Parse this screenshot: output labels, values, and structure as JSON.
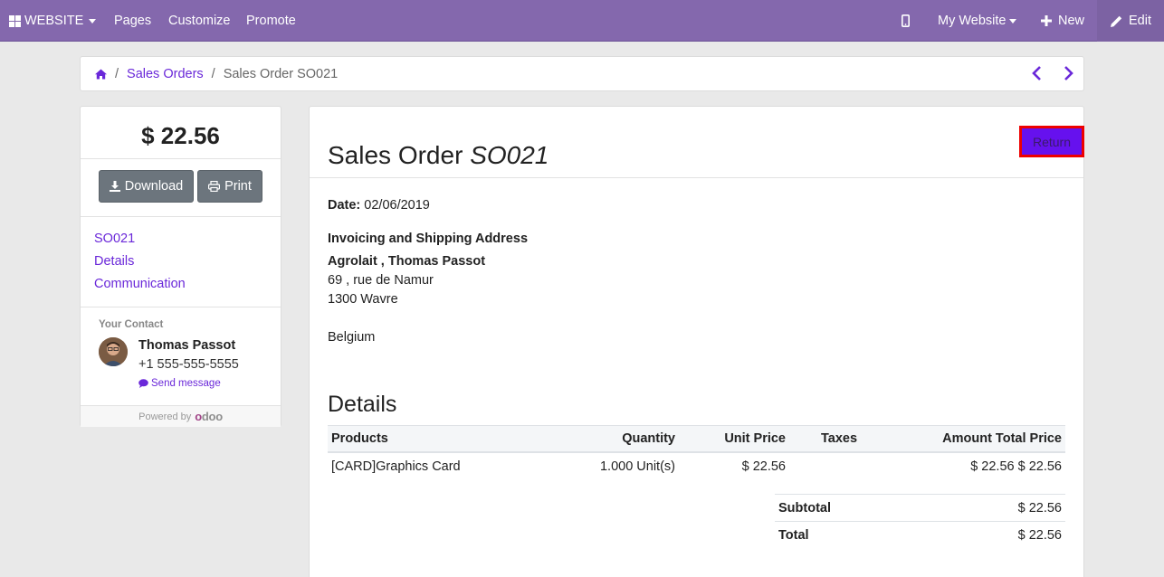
{
  "topbar": {
    "website_label": "WEBSITE",
    "menu": [
      "Pages",
      "Customize",
      "Promote"
    ],
    "my_website": "My Website",
    "new_label": "New",
    "edit_label": "Edit"
  },
  "breadcrumb": {
    "home_icon": "home-icon",
    "sales_orders": "Sales Orders",
    "current": "Sales Order SO021"
  },
  "sidebar": {
    "amount": "$ 22.56",
    "download_label": "Download",
    "print_label": "Print",
    "links": [
      "SO021",
      "Details",
      "Communication"
    ],
    "contact_title": "Your Contact",
    "contact_name": "Thomas Passot",
    "contact_phone": "+1 555-555-5555",
    "send_message": "Send message",
    "powered_by": "Powered by",
    "powered_logo": "odoo"
  },
  "order": {
    "title_prefix": "Sales Order",
    "title_ref": "SO021",
    "return_label": "Return",
    "date_label": "Date:",
    "date_value": "02/06/2019",
    "address_heading": "Invoicing and Shipping Address",
    "address_name": "Agrolait , Thomas Passot",
    "address_street": "69 , rue de Namur",
    "address_city": "1300 Wavre",
    "address_country": "Belgium"
  },
  "details": {
    "title": "Details",
    "columns": [
      "Products",
      "Quantity",
      "Unit Price",
      "Taxes",
      "Amount Total Price"
    ],
    "rows": [
      {
        "product": "[CARD]Graphics Card",
        "quantity": "1.000 Unit(s)",
        "unit_price": "$ 22.56",
        "taxes": "",
        "amount": "$ 22.56 $ 22.56"
      }
    ],
    "subtotal_label": "Subtotal",
    "subtotal_value": "$ 22.56",
    "total_label": "Total",
    "total_value": "$ 22.56"
  },
  "colors": {
    "topbar": "#8468ad",
    "link": "#6a28d9",
    "return_bg": "#6611ee",
    "return_border": "#ee0000"
  }
}
